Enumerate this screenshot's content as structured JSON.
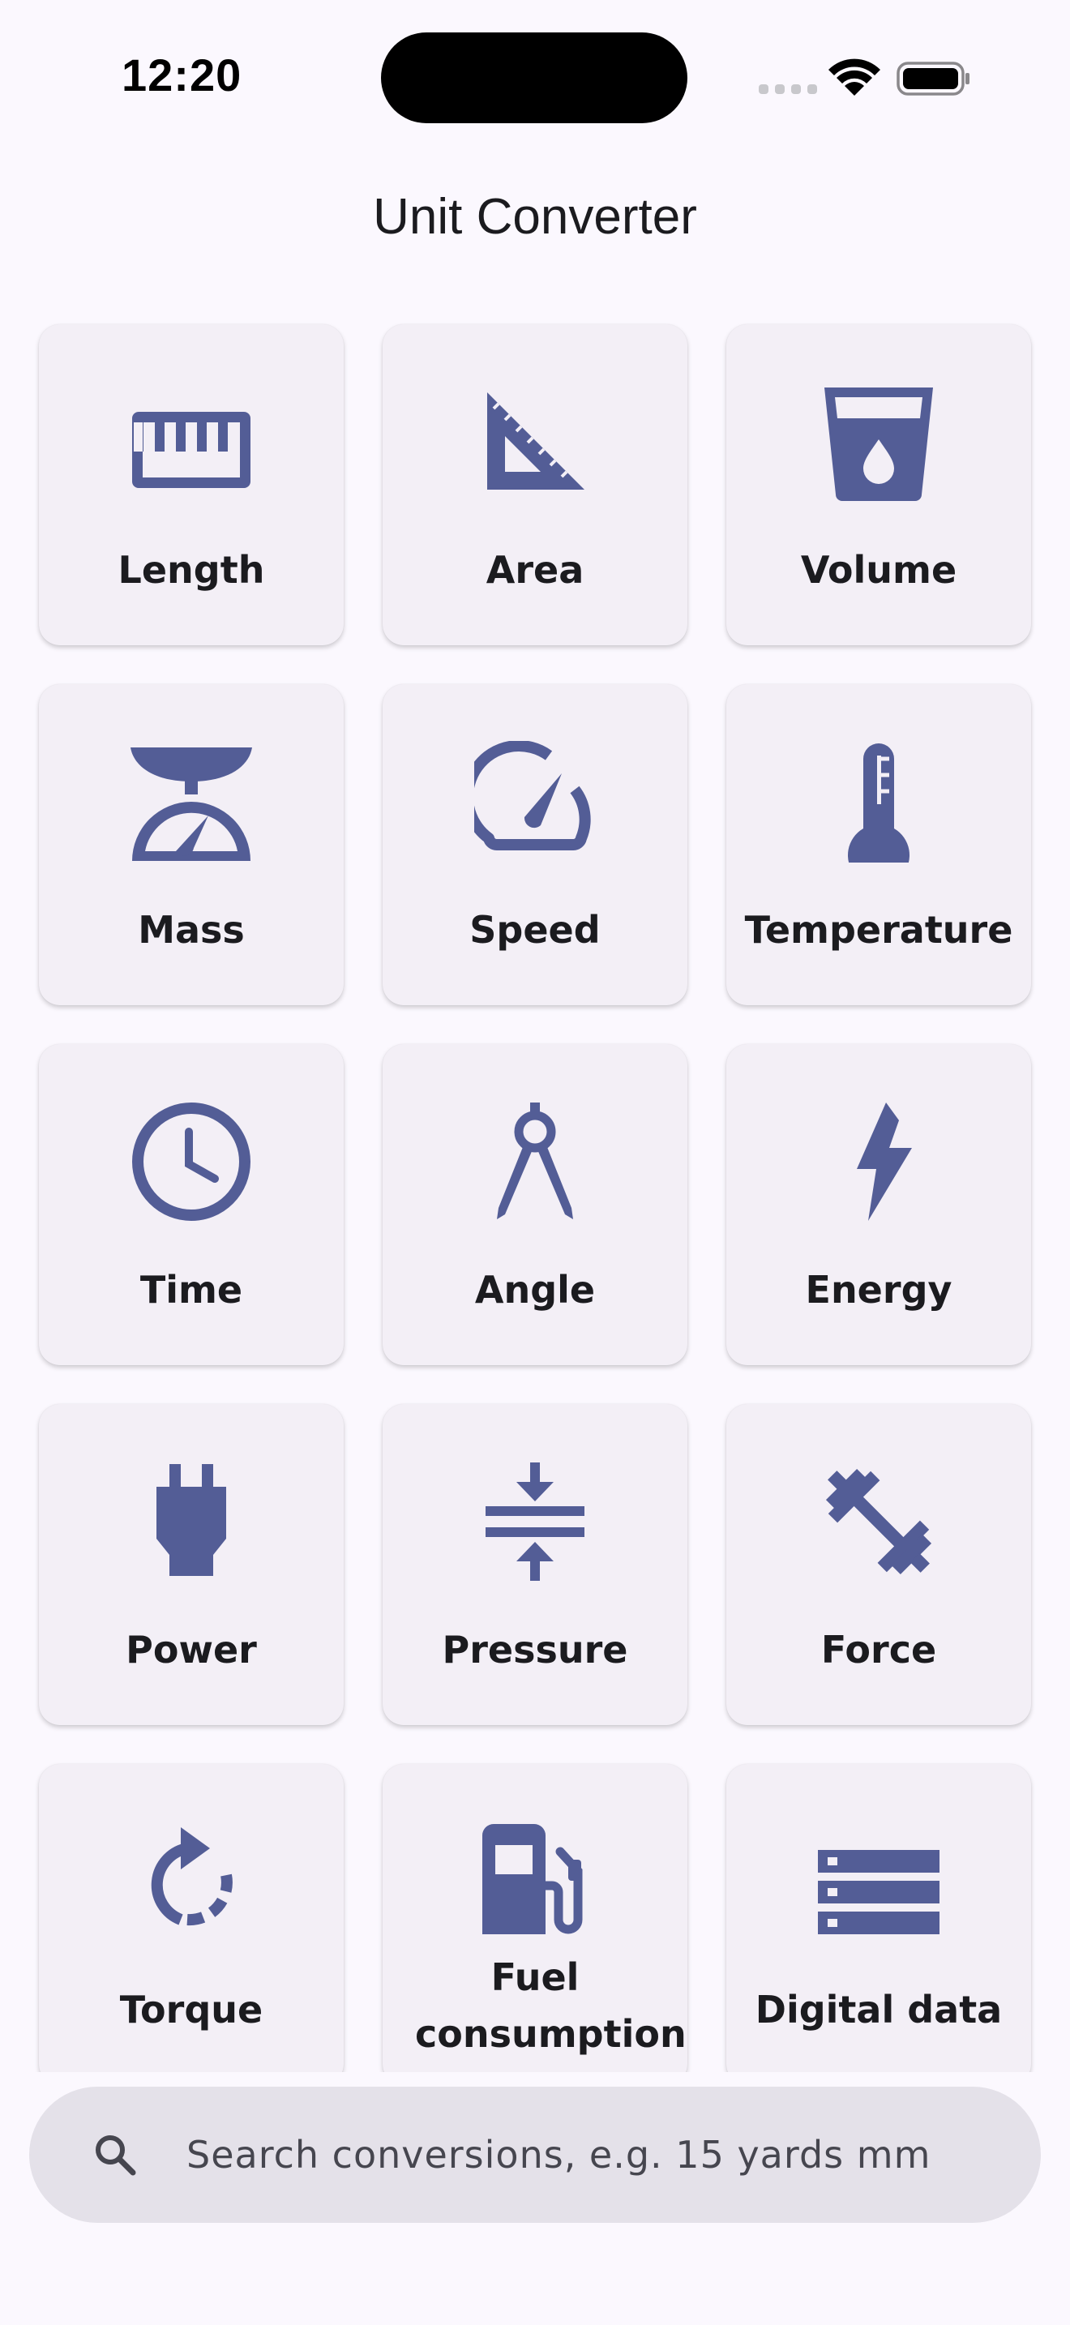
{
  "status_bar": {
    "time": "12:20"
  },
  "header": {
    "title": "Unit Converter"
  },
  "categories": [
    {
      "label": "Length",
      "icon": "ruler-icon"
    },
    {
      "label": "Area",
      "icon": "set-square-icon"
    },
    {
      "label": "Volume",
      "icon": "cup-with-drop-icon"
    },
    {
      "label": "Mass",
      "icon": "scale-icon"
    },
    {
      "label": "Speed",
      "icon": "speedometer-icon"
    },
    {
      "label": "Temperature",
      "icon": "thermometer-icon"
    },
    {
      "label": "Time",
      "icon": "clock-icon"
    },
    {
      "label": "Angle",
      "icon": "compass-icon"
    },
    {
      "label": "Energy",
      "icon": "lightning-bolt-icon"
    },
    {
      "label": "Power",
      "icon": "power-plug-icon"
    },
    {
      "label": "Pressure",
      "icon": "compress-arrows-icon"
    },
    {
      "label": "Force",
      "icon": "dumbbell-icon"
    },
    {
      "label": "Torque",
      "icon": "rotate-dashed-icon"
    },
    {
      "label": "Fuel consumption",
      "icon": "fuel-pump-icon"
    },
    {
      "label": "Digital data",
      "icon": "storage-server-icon"
    }
  ],
  "search": {
    "placeholder": "Search conversions, e.g. 15 yards mm"
  },
  "colors": {
    "background": "#fbf8fe",
    "tile": "#f3eff6",
    "icon": "#535d96",
    "search_bar": "#e4e1e9"
  }
}
